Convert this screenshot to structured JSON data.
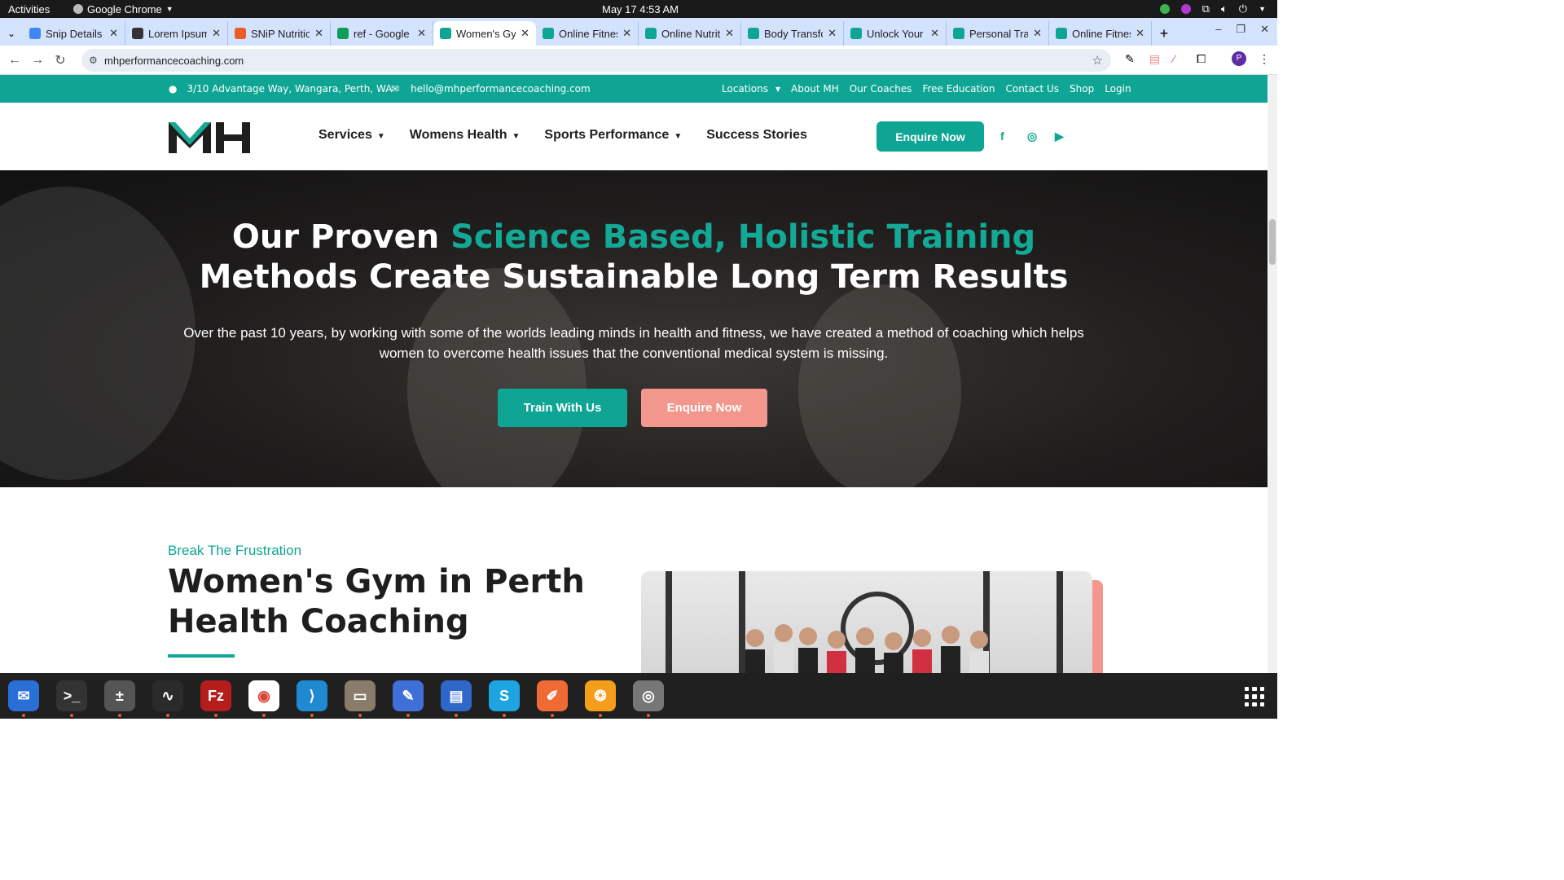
{
  "system": {
    "activities": "Activities",
    "app_name": "Google Chrome",
    "clock": "May 17  4:53 AM"
  },
  "tabs": [
    {
      "title": "Snip Details",
      "icon": "docs-icon",
      "color": "#4285f4"
    },
    {
      "title": "Lorem Ipsum",
      "icon": "lorem-icon",
      "color": "#333333"
    },
    {
      "title": "SNiP Nutrition",
      "icon": "snip-icon",
      "color": "#e85d2a"
    },
    {
      "title": "ref - Google",
      "icon": "sheets-icon",
      "color": "#0f9d58"
    },
    {
      "title": "Women's Gym",
      "icon": "mh-icon",
      "color": "#0fa594",
      "active": true
    },
    {
      "title": "Online Fitness",
      "icon": "mh-icon",
      "color": "#0fa594"
    },
    {
      "title": "Online Nutrition",
      "icon": "mh-icon",
      "color": "#0fa594"
    },
    {
      "title": "Body Transformation",
      "icon": "mh-icon",
      "color": "#0fa594"
    },
    {
      "title": "Unlock Your",
      "icon": "mh-icon",
      "color": "#0fa594"
    },
    {
      "title": "Personal Training",
      "icon": "mh-icon",
      "color": "#0fa594"
    },
    {
      "title": "Online Fitness",
      "icon": "mh-icon",
      "color": "#0fa594"
    }
  ],
  "browser": {
    "url": "mhperformancecoaching.com",
    "profile_initial": "P"
  },
  "site": {
    "address": "3/10 Advantage Way, Wangara, Perth, WA",
    "email": "hello@mhperformancecoaching.com",
    "top_links": [
      "Locations",
      "About MH",
      "Our Coaches",
      "Free Education",
      "Contact Us",
      "Shop",
      "Login"
    ],
    "menu": [
      {
        "label": "Services",
        "dropdown": true
      },
      {
        "label": "Womens Health",
        "dropdown": true
      },
      {
        "label": "Sports Performance",
        "dropdown": true
      },
      {
        "label": "Success Stories",
        "dropdown": false
      }
    ],
    "enquire_label": "Enquire Now",
    "social": [
      "facebook-icon",
      "instagram-icon",
      "youtube-icon"
    ],
    "brand_color": "#0fa594",
    "accent_color": "#f3968c"
  },
  "hero": {
    "line1_a": "Our Proven ",
    "line1_b": "Science Based, Holistic Training",
    "line2": "Methods Create Sustainable Long Term Results",
    "paragraph": "Over the past 10 years, by working with some of the worlds leading minds in health and fitness, we have created a method of coaching which helps women to overcome health issues that the conventional medical system is missing.",
    "primary_button": "Train With Us",
    "secondary_button": "Enquire Now"
  },
  "intro": {
    "eyebrow": "Break The Frustration",
    "heading_line1": "Women's Gym in Perth",
    "heading_line2": "Health Coaching"
  },
  "dock": [
    "thunderbird-icon",
    "terminal-icon",
    "calculator-icon",
    "system-monitor-icon",
    "filezilla-icon",
    "chrome-icon",
    "vscode-icon",
    "files-icon",
    "text-editor-icon",
    "libreoffice-writer-icon",
    "skype-icon",
    "postman-icon",
    "firefox-dev-icon",
    "disk-icon"
  ]
}
